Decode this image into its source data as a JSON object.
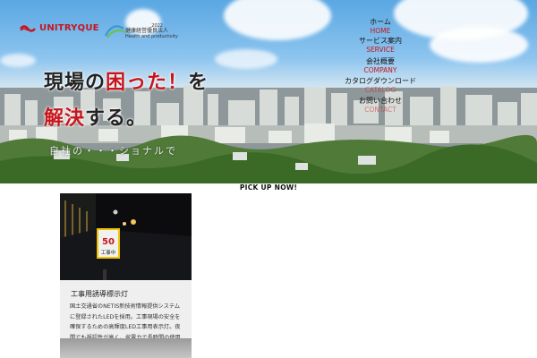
{
  "brand": {
    "name": "UNITRYQUE",
    "cert_label": "健康経営優良法人",
    "cert_sub": "Health and productivity",
    "cert_year": "2022"
  },
  "hero": {
    "line1_pre": "現場の",
    "line1_red": "困った！",
    "line1_post": "を",
    "line2_red": "解決",
    "line2_post": "する。",
    "sub": "自社の・・・ショナルで"
  },
  "nav": {
    "items": [
      {
        "jp": "ホーム",
        "en": "HOME"
      },
      {
        "jp": "サービス案内",
        "en": "SERVICE"
      },
      {
        "jp": "会社概要",
        "en": "COMPANY"
      },
      {
        "jp": "カタログダウンロード",
        "en": "CATALOG"
      },
      {
        "jp": "お問い合わせ",
        "en": "CONTACT"
      }
    ]
  },
  "section": {
    "pickup_title": "PICK UP NOW!"
  },
  "cards": [
    {
      "sign_top": "50",
      "sign_bottom": "工事中",
      "title": "工事用誘導標示灯",
      "body": "国土交通省のNETIS新技術情報提供システムに登録されたLEDを採用。工事現場の安全を確保するための高輝度LED工事用表示灯。夜間でも視認性が高く、省電力で長時間の使用に対応します。"
    }
  ],
  "colors": {
    "accent": "#c8151b"
  }
}
